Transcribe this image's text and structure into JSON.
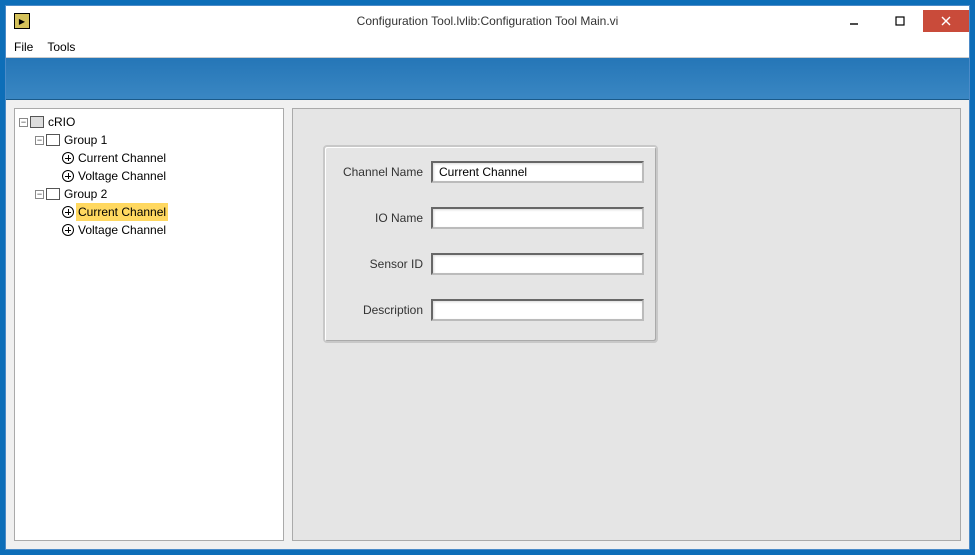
{
  "window": {
    "title": "Configuration Tool.lvlib:Configuration Tool Main.vi"
  },
  "menu": {
    "file": "File",
    "tools": "Tools"
  },
  "tree": {
    "root": "cRIO",
    "group1": {
      "label": "Group 1",
      "current": "Current Channel",
      "voltage": "Voltage Channel"
    },
    "group2": {
      "label": "Group 2",
      "current": "Current Channel",
      "voltage": "Voltage Channel"
    }
  },
  "form": {
    "channel_name_label": "Channel Name",
    "channel_name_value": "Current Channel",
    "io_name_label": "IO Name",
    "io_name_value": "",
    "sensor_id_label": "Sensor ID",
    "sensor_id_value": "",
    "description_label": "Description",
    "description_value": ""
  }
}
